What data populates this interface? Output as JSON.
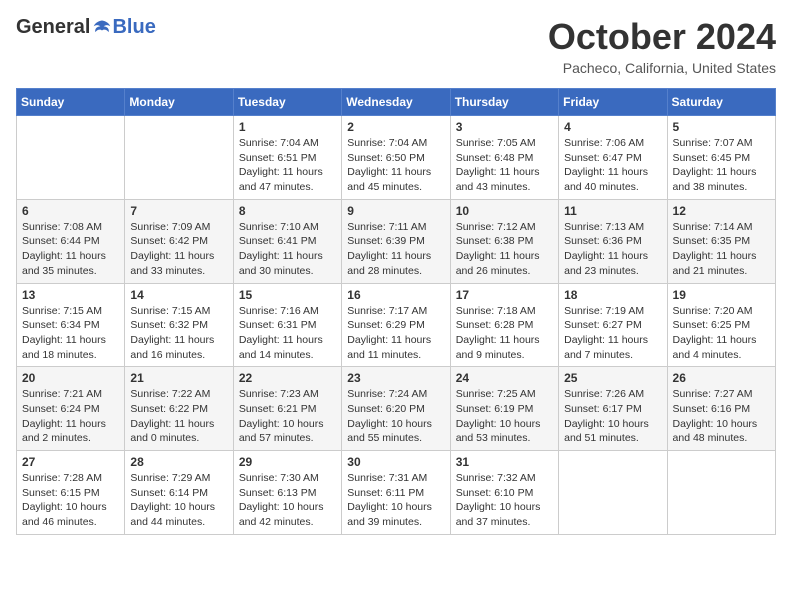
{
  "logo": {
    "general": "General",
    "blue": "Blue"
  },
  "header": {
    "month": "October 2024",
    "location": "Pacheco, California, United States"
  },
  "days_of_week": [
    "Sunday",
    "Monday",
    "Tuesday",
    "Wednesday",
    "Thursday",
    "Friday",
    "Saturday"
  ],
  "weeks": [
    [
      {
        "day": "",
        "info": ""
      },
      {
        "day": "",
        "info": ""
      },
      {
        "day": "1",
        "info": "Sunrise: 7:04 AM\nSunset: 6:51 PM\nDaylight: 11 hours and 47 minutes."
      },
      {
        "day": "2",
        "info": "Sunrise: 7:04 AM\nSunset: 6:50 PM\nDaylight: 11 hours and 45 minutes."
      },
      {
        "day": "3",
        "info": "Sunrise: 7:05 AM\nSunset: 6:48 PM\nDaylight: 11 hours and 43 minutes."
      },
      {
        "day": "4",
        "info": "Sunrise: 7:06 AM\nSunset: 6:47 PM\nDaylight: 11 hours and 40 minutes."
      },
      {
        "day": "5",
        "info": "Sunrise: 7:07 AM\nSunset: 6:45 PM\nDaylight: 11 hours and 38 minutes."
      }
    ],
    [
      {
        "day": "6",
        "info": "Sunrise: 7:08 AM\nSunset: 6:44 PM\nDaylight: 11 hours and 35 minutes."
      },
      {
        "day": "7",
        "info": "Sunrise: 7:09 AM\nSunset: 6:42 PM\nDaylight: 11 hours and 33 minutes."
      },
      {
        "day": "8",
        "info": "Sunrise: 7:10 AM\nSunset: 6:41 PM\nDaylight: 11 hours and 30 minutes."
      },
      {
        "day": "9",
        "info": "Sunrise: 7:11 AM\nSunset: 6:39 PM\nDaylight: 11 hours and 28 minutes."
      },
      {
        "day": "10",
        "info": "Sunrise: 7:12 AM\nSunset: 6:38 PM\nDaylight: 11 hours and 26 minutes."
      },
      {
        "day": "11",
        "info": "Sunrise: 7:13 AM\nSunset: 6:36 PM\nDaylight: 11 hours and 23 minutes."
      },
      {
        "day": "12",
        "info": "Sunrise: 7:14 AM\nSunset: 6:35 PM\nDaylight: 11 hours and 21 minutes."
      }
    ],
    [
      {
        "day": "13",
        "info": "Sunrise: 7:15 AM\nSunset: 6:34 PM\nDaylight: 11 hours and 18 minutes."
      },
      {
        "day": "14",
        "info": "Sunrise: 7:15 AM\nSunset: 6:32 PM\nDaylight: 11 hours and 16 minutes."
      },
      {
        "day": "15",
        "info": "Sunrise: 7:16 AM\nSunset: 6:31 PM\nDaylight: 11 hours and 14 minutes."
      },
      {
        "day": "16",
        "info": "Sunrise: 7:17 AM\nSunset: 6:29 PM\nDaylight: 11 hours and 11 minutes."
      },
      {
        "day": "17",
        "info": "Sunrise: 7:18 AM\nSunset: 6:28 PM\nDaylight: 11 hours and 9 minutes."
      },
      {
        "day": "18",
        "info": "Sunrise: 7:19 AM\nSunset: 6:27 PM\nDaylight: 11 hours and 7 minutes."
      },
      {
        "day": "19",
        "info": "Sunrise: 7:20 AM\nSunset: 6:25 PM\nDaylight: 11 hours and 4 minutes."
      }
    ],
    [
      {
        "day": "20",
        "info": "Sunrise: 7:21 AM\nSunset: 6:24 PM\nDaylight: 11 hours and 2 minutes."
      },
      {
        "day": "21",
        "info": "Sunrise: 7:22 AM\nSunset: 6:22 PM\nDaylight: 11 hours and 0 minutes."
      },
      {
        "day": "22",
        "info": "Sunrise: 7:23 AM\nSunset: 6:21 PM\nDaylight: 10 hours and 57 minutes."
      },
      {
        "day": "23",
        "info": "Sunrise: 7:24 AM\nSunset: 6:20 PM\nDaylight: 10 hours and 55 minutes."
      },
      {
        "day": "24",
        "info": "Sunrise: 7:25 AM\nSunset: 6:19 PM\nDaylight: 10 hours and 53 minutes."
      },
      {
        "day": "25",
        "info": "Sunrise: 7:26 AM\nSunset: 6:17 PM\nDaylight: 10 hours and 51 minutes."
      },
      {
        "day": "26",
        "info": "Sunrise: 7:27 AM\nSunset: 6:16 PM\nDaylight: 10 hours and 48 minutes."
      }
    ],
    [
      {
        "day": "27",
        "info": "Sunrise: 7:28 AM\nSunset: 6:15 PM\nDaylight: 10 hours and 46 minutes."
      },
      {
        "day": "28",
        "info": "Sunrise: 7:29 AM\nSunset: 6:14 PM\nDaylight: 10 hours and 44 minutes."
      },
      {
        "day": "29",
        "info": "Sunrise: 7:30 AM\nSunset: 6:13 PM\nDaylight: 10 hours and 42 minutes."
      },
      {
        "day": "30",
        "info": "Sunrise: 7:31 AM\nSunset: 6:11 PM\nDaylight: 10 hours and 39 minutes."
      },
      {
        "day": "31",
        "info": "Sunrise: 7:32 AM\nSunset: 6:10 PM\nDaylight: 10 hours and 37 minutes."
      },
      {
        "day": "",
        "info": ""
      },
      {
        "day": "",
        "info": ""
      }
    ]
  ]
}
